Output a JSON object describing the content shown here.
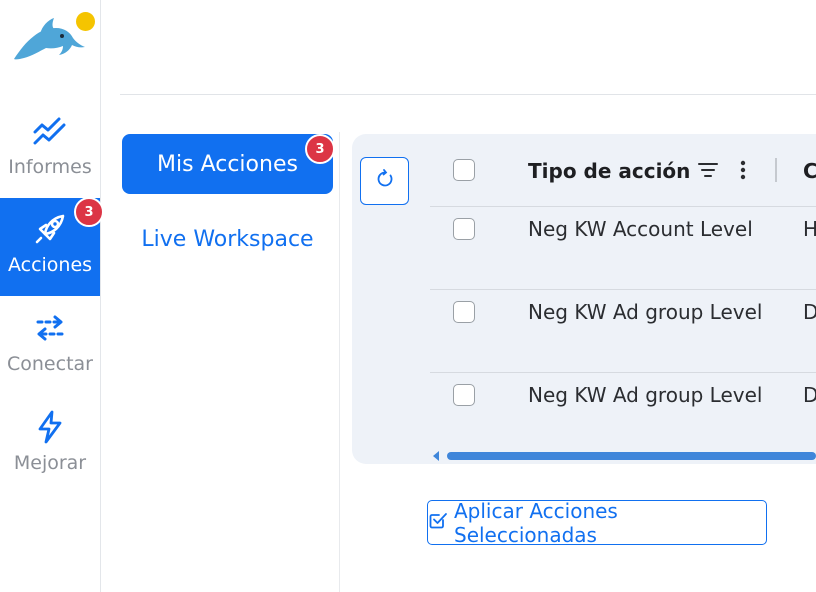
{
  "brand": {
    "logo_icon": "dolphin-logo",
    "notification_dot_color": "#f5c400"
  },
  "colors": {
    "accent": "#1170f0",
    "badge": "#dc3545",
    "panel_bg": "#eef2f8"
  },
  "sidebar": {
    "items": [
      {
        "label": "Informes",
        "icon": "chart-trend-icon",
        "active": false
      },
      {
        "label": "Acciones",
        "icon": "rocket-icon",
        "active": true,
        "badge": "3"
      },
      {
        "label": "Conectar",
        "icon": "swap-arrows-icon",
        "active": false
      },
      {
        "label": "Mejorar",
        "icon": "lightning-icon",
        "active": false
      }
    ]
  },
  "subnav": {
    "items": [
      {
        "label": "Mis Acciones",
        "active": true,
        "badge": "3"
      },
      {
        "label": "Live Workspace",
        "active": false
      }
    ]
  },
  "table": {
    "columns": [
      {
        "label": "Tipo de acción"
      },
      {
        "label": "C"
      }
    ],
    "rows": [
      {
        "tipo": "Neg KW Account Level",
        "next": "H"
      },
      {
        "tipo": "Neg KW Ad group Level",
        "next": "D"
      },
      {
        "tipo": "Neg KW Ad group Level",
        "next": "D"
      }
    ]
  },
  "actions": {
    "apply_label": "Aplicar Acciones Seleccionadas"
  }
}
